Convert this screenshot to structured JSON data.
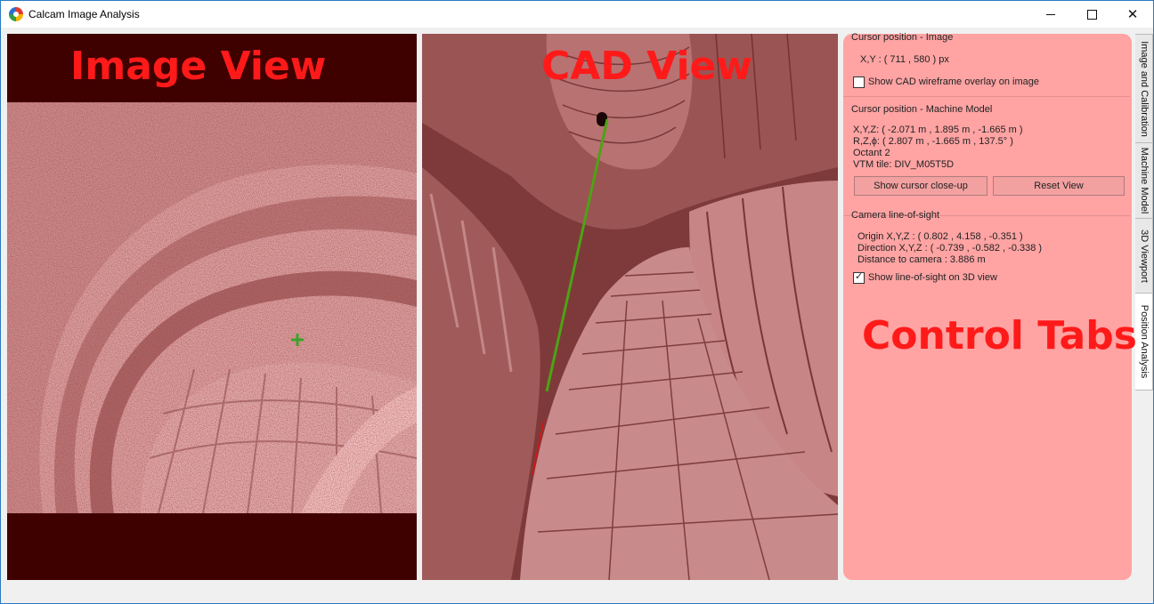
{
  "window": {
    "title": "Calcam Image Analysis"
  },
  "image_view": {
    "label": "Image View",
    "cursor_mark": "green-crosshair"
  },
  "cad_view": {
    "label": "CAD View",
    "sightline_color": "#4ca314",
    "ray_color": "#e01010"
  },
  "controls": {
    "overlay_label": "Control Tabs",
    "image_group": {
      "title": "Cursor position - Image",
      "xy": "X,Y : ( 711 , 580 ) px",
      "wireframe_checkbox": {
        "label": "Show CAD wireframe overlay on image",
        "checked": false
      }
    },
    "model_group": {
      "title": "Cursor position - Machine Model",
      "xyz": "X,Y,Z: ( -2.071 m , 1.895 m , -1.665 m )",
      "rzphi": "R,Z,ϕ: ( 2.807 m , -1.665 m , 137.5° )",
      "octant": "Octant 2",
      "tile": "VTM tile: DIV_M05T5D",
      "closeup_button": "Show cursor close-up",
      "reset_button": "Reset View"
    },
    "sight_group": {
      "title": "Camera line-of-sight",
      "origin": "Origin X,Y,Z : ( 0.802 , 4.158 , -0.351 )",
      "direction": "Direction X,Y,Z : ( -0.739 , -0.582 , -0.338 )",
      "distance": "Distance to camera : 3.886 m",
      "los_checkbox": {
        "label": "Show line-of-sight on 3D view",
        "checked": true
      }
    }
  },
  "tabs": [
    {
      "label": "Image and Calibration",
      "active": false
    },
    {
      "label": "Machine Model",
      "active": false
    },
    {
      "label": "3D Viewport",
      "active": false
    },
    {
      "label": "Position Analysis",
      "active": true
    }
  ],
  "colors": {
    "label_red": "#ff1a1a",
    "panel_pink": "#ffa3a3",
    "image_dark": "#3f0000"
  }
}
